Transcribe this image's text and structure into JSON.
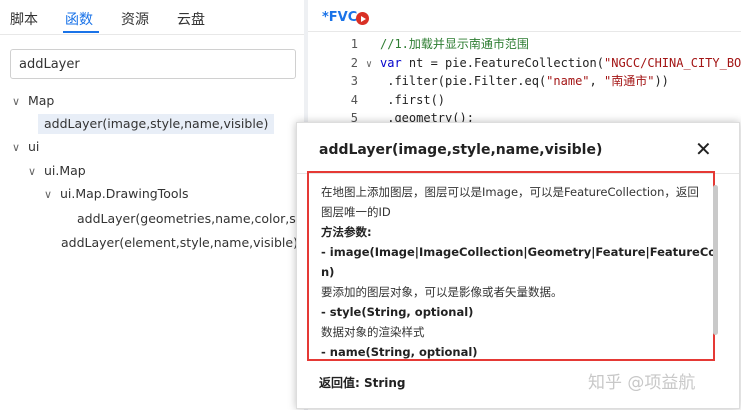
{
  "left_tabs": [
    "脚本",
    "函数",
    "资源",
    "云盘"
  ],
  "search_value": "addLayer",
  "tree": {
    "map": "Map",
    "map_addlayer": "addLayer(image,style,name,visible)",
    "ui": "ui",
    "ui_map": "ui.Map",
    "drawing_tools": "ui.Map.DrawingTools",
    "dt_addlayer": "addLayer(geometries,name,color,shown,l",
    "ui_map_addlayer": "addLayer(element,style,name,visible)"
  },
  "editor": {
    "tab_label": "*FVC",
    "lines": [
      {
        "n": "1",
        "fold": "",
        "segs": [
          {
            "c": "c-comment",
            "t": "//1.加载并显示南通市范围"
          }
        ]
      },
      {
        "n": "2",
        "fold": "∨",
        "segs": [
          {
            "c": "c-kw",
            "t": "var"
          },
          {
            "c": "c-plain",
            "t": " nt = pie."
          },
          {
            "c": "c-fn",
            "t": "FeatureCollection"
          },
          {
            "c": "c-plain",
            "t": "("
          },
          {
            "c": "c-str",
            "t": "\"NGCC/CHINA_CITY_BOUND"
          }
        ]
      },
      {
        "n": "3",
        "fold": "",
        "segs": [
          {
            "c": "c-plain",
            "t": "           .filter(pie.Filter.eq("
          },
          {
            "c": "c-str",
            "t": "\"name\""
          },
          {
            "c": "c-plain",
            "t": ", "
          },
          {
            "c": "c-str",
            "t": "\"南通市\""
          },
          {
            "c": "c-plain",
            "t": "))"
          }
        ]
      },
      {
        "n": "4",
        "fold": "",
        "segs": [
          {
            "c": "c-plain",
            "t": "           .first()"
          }
        ]
      },
      {
        "n": "5",
        "fold": "",
        "segs": [
          {
            "c": "c-plain",
            "t": "           .geometry();"
          }
        ]
      }
    ]
  },
  "popup": {
    "title": "addLayer(image,style,name,visible)",
    "doc": [
      {
        "t": "在地图上添加图层，图层可以是Image，可以是FeatureCollection，返回",
        "b": false
      },
      {
        "t": "图层唯一的ID",
        "b": false
      },
      {
        "t": "方法参数:",
        "b": true
      },
      {
        "t": "- image(Image|ImageCollection|Geometry|Feature|FeatureCollectio",
        "b": true
      },
      {
        "t": "n)",
        "b": true
      },
      {
        "t": "要添加的图层对象，可以是影像或者矢量数据。",
        "b": false
      },
      {
        "t": "- style(String, optional)",
        "b": true
      },
      {
        "t": "数据对象的渲染样式",
        "b": false
      },
      {
        "t": "- name(String, optional)",
        "b": true
      }
    ],
    "return_label": "返回值: String"
  },
  "watermark": "知乎 @项益航"
}
